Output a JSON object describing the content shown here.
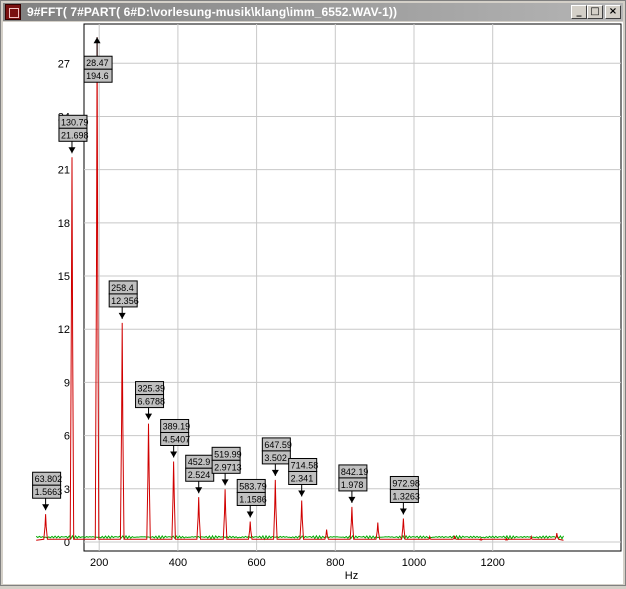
{
  "window": {
    "title": "9#FFT( 7#PART( 6#D:\\vorlesung-musik\\klang\\imm_6552.WAV-1))",
    "minimize_glyph": "_",
    "maximize_glyph": "□",
    "close_glyph": "×",
    "icon": "waveform-app-icon"
  },
  "chart_data": {
    "type": "line",
    "title": "",
    "xlabel": "Hz",
    "ylabel": "",
    "xlim": [
      40,
      1380
    ],
    "ylim": [
      -0.5,
      29.5
    ],
    "x_ticks": [
      200,
      400,
      600,
      800,
      1000,
      1200
    ],
    "y_ticks": [
      0,
      3,
      6,
      9,
      12,
      15,
      18,
      21,
      24,
      27
    ],
    "grid": true,
    "colors": {
      "series": "#d00000",
      "noise": "#00aa00",
      "grid": "#c8c8c8",
      "label_bg": "#c0c0c0"
    },
    "peaks": [
      {
        "x": 63.802,
        "y": 1.5663,
        "label_x": "63.802",
        "label_y": "1.5663"
      },
      {
        "x": 130.79,
        "y": 21.698,
        "label_x": "130.79",
        "label_y": "21.698"
      },
      {
        "x": 194.6,
        "y": 28.47,
        "label_x": "28.47",
        "label_y": "194.6"
      },
      {
        "x": 258.4,
        "y": 12.356,
        "label_x": "258.4",
        "label_y": "12.356"
      },
      {
        "x": 325.39,
        "y": 6.6788,
        "label_x": "325.39",
        "label_y": "6.6788"
      },
      {
        "x": 389.19,
        "y": 4.5407,
        "label_x": "389.19",
        "label_y": "4.5407"
      },
      {
        "x": 452.9,
        "y": 2.524,
        "label_x": "452.9",
        "label_y": "2.524"
      },
      {
        "x": 519.99,
        "y": 2.9713,
        "label_x": "519.99",
        "label_y": "2.9713"
      },
      {
        "x": 583.79,
        "y": 1.1586,
        "label_x": "583.79",
        "label_y": "1.1586"
      },
      {
        "x": 647.59,
        "y": 3.502,
        "label_x": "647.59",
        "label_y": "3.502"
      },
      {
        "x": 714.58,
        "y": 2.341,
        "label_x": "714.58",
        "label_y": "2.341"
      },
      {
        "x": 842.19,
        "y": 1.978,
        "label_x": "842.19",
        "label_y": "1.978"
      },
      {
        "x": 972.98,
        "y": 1.3263,
        "label_x": "972.98",
        "label_y": "1.3263"
      }
    ],
    "minor_peaks": [
      {
        "x": 778,
        "y": 0.7
      },
      {
        "x": 908,
        "y": 1.1
      },
      {
        "x": 1040,
        "y": 0.3
      },
      {
        "x": 1103,
        "y": 0.35
      },
      {
        "x": 1170,
        "y": 0.2
      },
      {
        "x": 1235,
        "y": 0.2
      },
      {
        "x": 1298,
        "y": 0.3
      },
      {
        "x": 1363,
        "y": 0.5
      }
    ]
  }
}
